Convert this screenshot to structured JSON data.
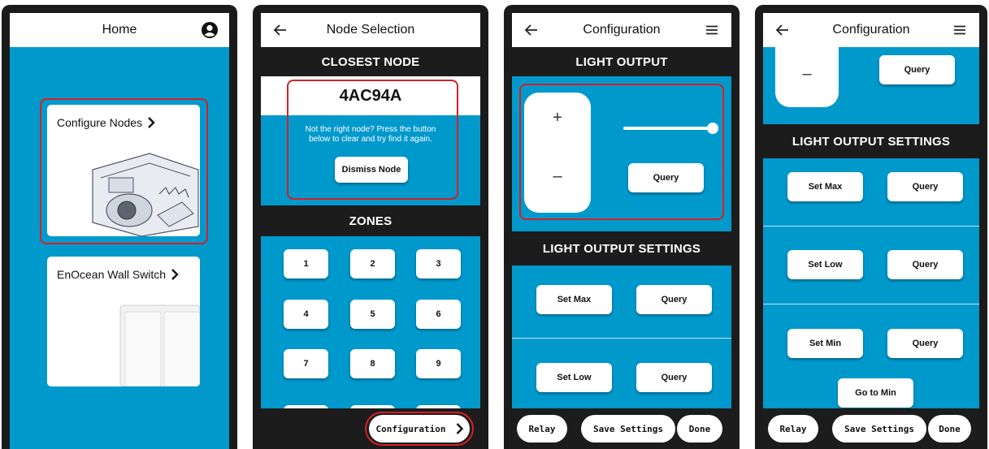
{
  "screen1": {
    "title": "Home",
    "cards": [
      {
        "label": "Configure Nodes",
        "icon": "chevron-right-icon"
      },
      {
        "label": "EnOcean Wall Switch",
        "icon": "chevron-right-icon"
      }
    ]
  },
  "screen2": {
    "title": "Node Selection",
    "closest_header": "CLOSEST NODE",
    "node_id": "4AC94A",
    "hint": "Not the right node? Press the button below to clear and try find it again.",
    "dismiss_label": "Dismiss Node",
    "zones_header": "ZONES",
    "zones": [
      "1",
      "2",
      "3",
      "4",
      "5",
      "6",
      "7",
      "8",
      "9"
    ],
    "config_label": "Configuration",
    "config_icon": "chevron-right-icon"
  },
  "screen3": {
    "title": "Configuration",
    "light_output_header": "LIGHT OUTPUT",
    "plus": "+",
    "minus": "–",
    "slider_value": 1.0,
    "query_label": "Query",
    "settings_header": "LIGHT OUTPUT SETTINGS",
    "set_max": "Set Max",
    "set_low": "Set Low",
    "bottom": {
      "relay": "Relay",
      "save": "Save Settings",
      "done": "Done"
    }
  },
  "screen4": {
    "title": "Configuration",
    "minus": "–",
    "query_label": "Query",
    "settings_header": "LIGHT OUTPUT SETTINGS",
    "set_max": "Set Max",
    "set_low": "Set Low",
    "set_min": "Set Min",
    "go_to_min": "Go to Min",
    "bottom": {
      "relay": "Relay",
      "save": "Save Settings",
      "done": "Done"
    }
  },
  "colors": {
    "accent": "#0099cc",
    "dark": "#1c1c1c",
    "highlight": "#d32027"
  }
}
